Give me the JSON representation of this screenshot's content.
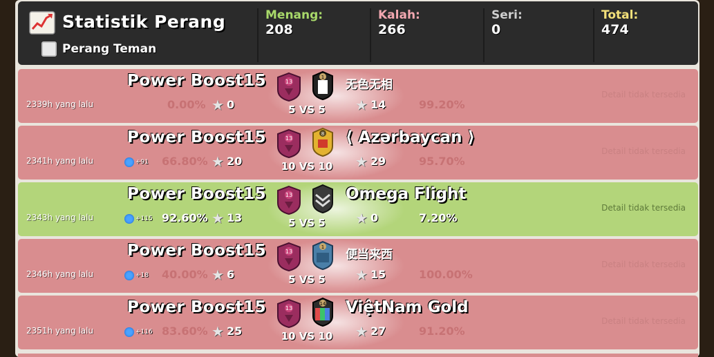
{
  "header": {
    "title": "Statistik Perang",
    "friendly_label": "Perang Teman",
    "stats": [
      {
        "label": "Menang:",
        "value": "208",
        "color": "#a8d86a"
      },
      {
        "label": "Kalah:",
        "value": "266",
        "color": "#f2a7b0"
      },
      {
        "label": "Seri:",
        "value": "0",
        "color": "#cfcfcf"
      },
      {
        "label": "Total:",
        "value": "474",
        "color": "#f3e07a"
      }
    ]
  },
  "rows": [
    {
      "result": "lose",
      "ago": "2339h yang lalu",
      "gems": "",
      "pct_a": "0.00%",
      "stars_a": "0",
      "clan_a": "Power Boost15",
      "level_a": "13",
      "level_b": "1",
      "clan_b": "无色无相",
      "vs": "5 VS 5",
      "stars_b": "14",
      "pct_b": "99.20%",
      "detail": "Detail tidak tersedia"
    },
    {
      "result": "lose",
      "ago": "2341h yang lalu",
      "gems": "+91",
      "pct_a": "66.80%",
      "stars_a": "20",
      "clan_a": "Power Boost15",
      "level_a": "13",
      "level_b": "8",
      "clan_b": "⟨ Azərbaycan ⟩",
      "vs": "10 VS 10",
      "stars_b": "29",
      "pct_b": "95.70%",
      "detail": "Detail tidak tersedia"
    },
    {
      "result": "win",
      "ago": "2343h yang lalu",
      "gems": "+115",
      "pct_a": "92.60%",
      "stars_a": "13",
      "clan_a": "Power Boost15",
      "level_a": "13",
      "level_b": "",
      "clan_b": "Omega Flight",
      "vs": "5 VS 5",
      "stars_b": "0",
      "pct_b": "7.20%",
      "detail": "Detail tidak tersedia"
    },
    {
      "result": "lose",
      "ago": "2346h yang lalu",
      "gems": "+18",
      "pct_a": "40.00%",
      "stars_a": "6",
      "clan_a": "Power Boost15",
      "level_a": "13",
      "level_b": "1",
      "clan_b": "便当来西",
      "vs": "5 VS 5",
      "stars_b": "15",
      "pct_b": "100.00%",
      "detail": "Detail tidak tersedia"
    },
    {
      "result": "lose",
      "ago": "2351h yang lalu",
      "gems": "+116",
      "pct_a": "83.60%",
      "stars_a": "25",
      "clan_a": "Power Boost15",
      "level_a": "13",
      "level_b": "14",
      "clan_b": "ViệtNam Gold",
      "vs": "10 VS 10",
      "stars_b": "27",
      "pct_b": "91.20%",
      "detail": "Detail tidak tersedia"
    }
  ],
  "icons": {
    "header": "chart-trend-icon",
    "gem": "gem-icon",
    "star": "star-icon",
    "badge_a": "clan-badge-purple-icon"
  },
  "colors": {
    "win_row": "#b3d57a",
    "lose_row": "#d98d8f",
    "header_bg": "#2b2b2b"
  }
}
